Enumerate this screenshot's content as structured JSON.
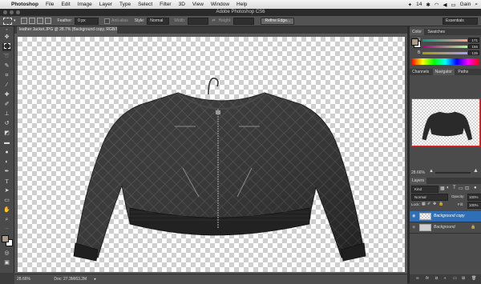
{
  "menubar": {
    "app_name": "Photoshop",
    "items": [
      "File",
      "Edit",
      "Image",
      "Layer",
      "Type",
      "Select",
      "Filter",
      "3D",
      "View",
      "Window",
      "Help"
    ],
    "status_num": "14",
    "user": "Gain"
  },
  "window": {
    "title": "Adobe Photoshop CS6"
  },
  "options": {
    "feather_label": "Feather:",
    "feather_value": "0 px",
    "antialias_label": "Anti-alias",
    "style_label": "Style:",
    "style_value": "Normal",
    "width_label": "Width:",
    "height_label": "Height:",
    "refine_label": "Refine Edge...",
    "workspace": "Essentials"
  },
  "document": {
    "tab_label": "leather Jacket.JPG @ 28.7% (Background copy, RGB/8*) *",
    "zoom": "28.66%",
    "doc_info": "Doc: 27.3M/63.2M"
  },
  "color_panel": {
    "tabs": [
      "Color",
      "Swatches"
    ],
    "r_label": "R",
    "g_label": "G",
    "b_label": "B",
    "r_value": "171",
    "g_value": "156",
    "b_value": "135"
  },
  "navigator_panel": {
    "tabs": [
      "Channels",
      "Navigator",
      "Paths"
    ],
    "zoom": "28.66%"
  },
  "layers_panel": {
    "title": "Layers",
    "filter": "Kind",
    "blend_mode": "Normal",
    "opacity_label": "Opacity:",
    "opacity_value": "100%",
    "lock_label": "Lock:",
    "fill_label": "Fill:",
    "fill_value": "100%",
    "layers": [
      {
        "name": "Background copy"
      },
      {
        "name": "Background"
      }
    ]
  },
  "colors": {
    "foreground": "#aa9c86",
    "background": "#ffffff",
    "selection": "#2f6fb5"
  }
}
